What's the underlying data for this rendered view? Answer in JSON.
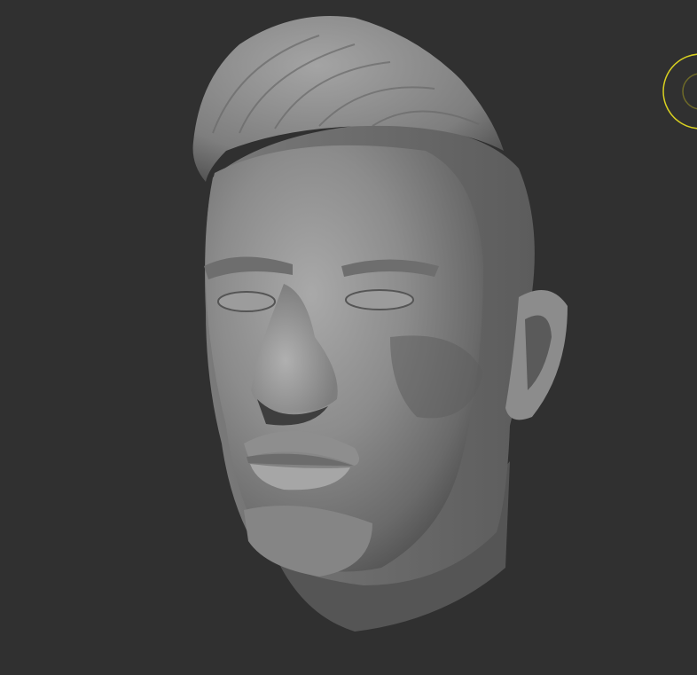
{
  "viewport": {
    "background_color": "#303030",
    "model": {
      "subject": "sculpted-head",
      "material_color": "#8a8a8a"
    },
    "brush_cursor": {
      "icon": "brush-cursor-icon",
      "outer_color": "#d8d020",
      "inner_color": "#6e6a28"
    }
  }
}
